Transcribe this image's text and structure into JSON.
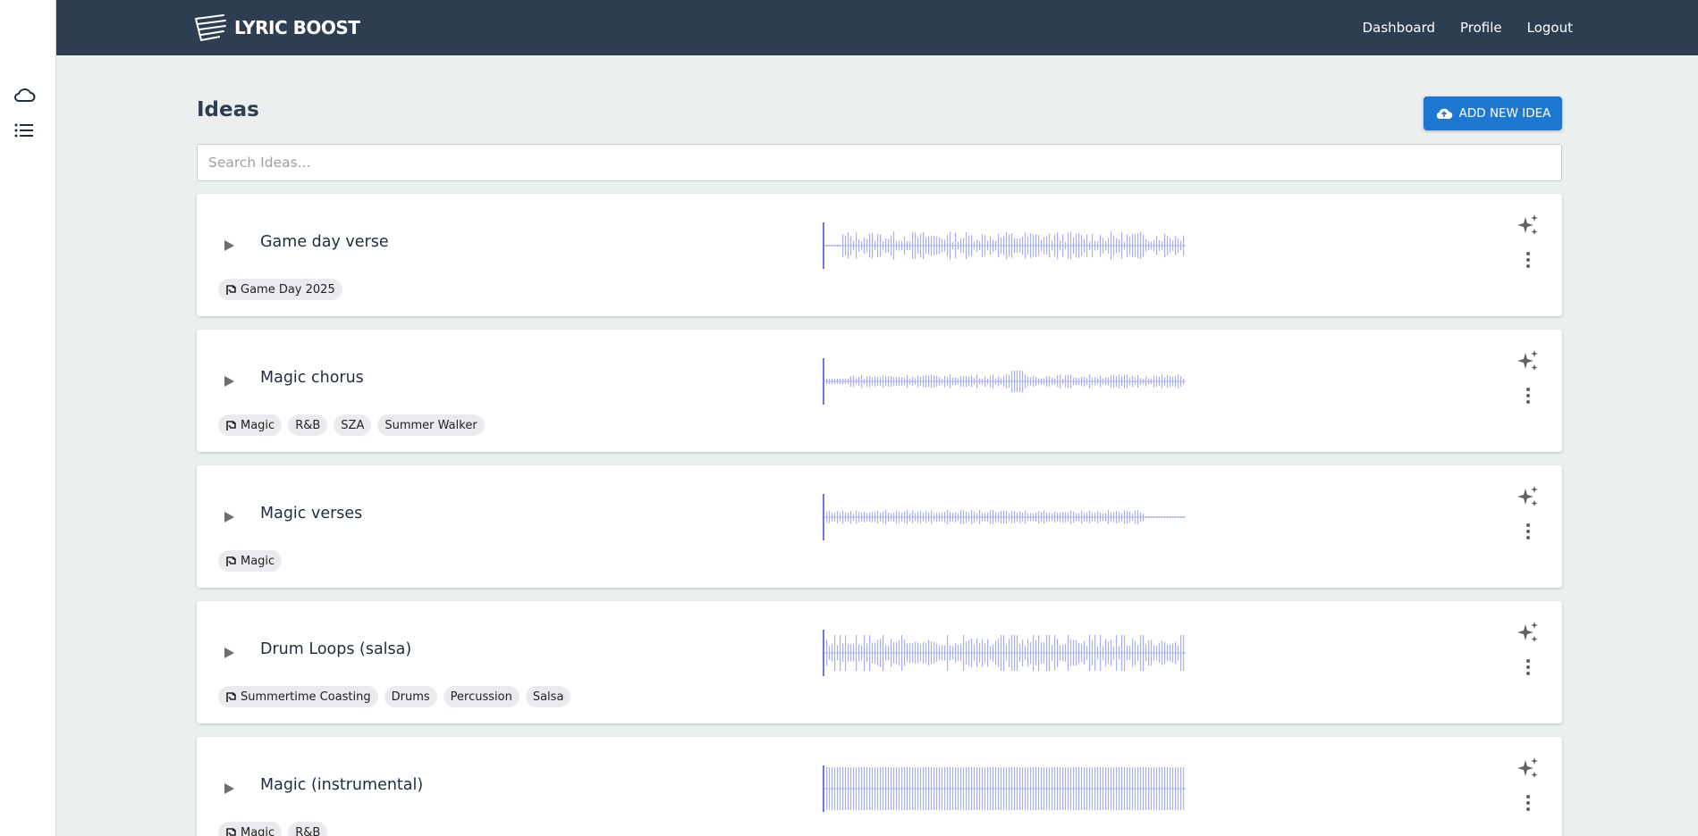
{
  "sidebar": {
    "items": [
      {
        "icon": "cloud-icon"
      },
      {
        "icon": "list-icon"
      }
    ]
  },
  "header": {
    "brand": "LYRIC BOOST",
    "nav": {
      "dashboard": "Dashboard",
      "profile": "Profile",
      "logout": "Logout"
    }
  },
  "page": {
    "title": "Ideas",
    "add_button_label": "ADD NEW IDEA",
    "search_placeholder": "Search Ideas..."
  },
  "colors": {
    "accent": "#1e78d2",
    "header": "#2d3e52",
    "waveform": "#a9b0f2"
  },
  "ideas": [
    {
      "title": "Game day verse",
      "tags": [
        {
          "label": "Game Day 2025",
          "project": true
        }
      ]
    },
    {
      "title": "Magic chorus",
      "tags": [
        {
          "label": "Magic",
          "project": true
        },
        {
          "label": "R&B"
        },
        {
          "label": "SZA"
        },
        {
          "label": "Summer Walker"
        }
      ]
    },
    {
      "title": "Magic verses",
      "tags": [
        {
          "label": "Magic",
          "project": true
        }
      ]
    },
    {
      "title": "Drum Loops (salsa)",
      "tags": [
        {
          "label": "Summertime Coasting",
          "project": true
        },
        {
          "label": "Drums"
        },
        {
          "label": "Percussion"
        },
        {
          "label": "Salsa"
        }
      ]
    },
    {
      "title": "Magic (instrumental)",
      "tags": [
        {
          "label": "Magic",
          "project": true
        },
        {
          "label": "R&B"
        }
      ]
    }
  ]
}
